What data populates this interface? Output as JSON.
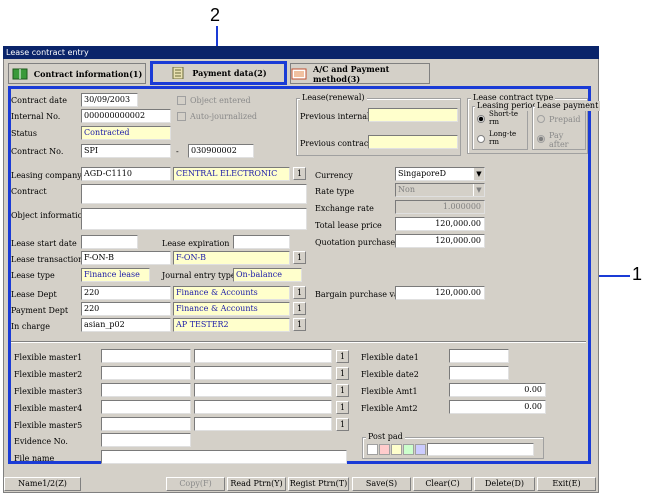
{
  "callouts": {
    "top": "2",
    "right": "1"
  },
  "window": {
    "title": "Lease contract entry"
  },
  "tabs": [
    {
      "label": "Contract information(1)"
    },
    {
      "label": "Payment data(2)"
    },
    {
      "label": "A/C and Payment method(3)"
    }
  ],
  "form": {
    "contract_date": {
      "label": "Contract date",
      "value": "30/09/2003"
    },
    "internal_no": {
      "label": "Internal No.",
      "value": "000000000002"
    },
    "status": {
      "label": "Status",
      "value": "Contracted"
    },
    "contract_no": {
      "label": "Contract No.",
      "value1": "SPI",
      "sep": "-",
      "value2": "030900002"
    },
    "object_entered": {
      "label": "Object entered"
    },
    "auto_journalized": {
      "label": "Auto-journalized"
    },
    "lease_renewal": {
      "title": "Lease(renewal)",
      "previous_internal": "Previous internal",
      "previous_contract": "Previous contract"
    },
    "lease_contract_type": {
      "title": "Lease contract type",
      "leasing_period": "Leasing period",
      "short": "Short-te rm",
      "long": "Long-te rm",
      "lease_payment": "Lease payment",
      "prepaid": "Prepaid",
      "pay_after": "Pay after"
    },
    "leasing_company": {
      "label": "Leasing company",
      "code": "AGD-C1110",
      "name": "CENTRAL ELECTRONIC"
    },
    "contract": {
      "label": "Contract"
    },
    "object_information": {
      "label": "Object information"
    },
    "currency": {
      "label": "Currency",
      "value": "SingaporeD"
    },
    "rate_type": {
      "label": "Rate type",
      "value": "Non"
    },
    "exchange_rate": {
      "label": "Exchange rate",
      "value": "1.000000"
    },
    "total_lease_price": {
      "label": "Total lease price",
      "value": "120,000.00"
    },
    "quotation_purchase": {
      "label": "Quotation purchase",
      "value": "120,000.00"
    },
    "lease_start_date": {
      "label": "Lease start date"
    },
    "lease_expiration": {
      "label": "Lease expiration"
    },
    "lease_transaction": {
      "label": "Lease transaction",
      "code": "F-ON-B",
      "name": "F-ON-B"
    },
    "lease_type": {
      "label": "Lease type",
      "value": "Finance lease"
    },
    "journal_entry_type": {
      "label": "Journal entry type",
      "value": "On-balance"
    },
    "lease_dept": {
      "label": "Lease Dept",
      "code": "220",
      "name": "Finance & Accounts"
    },
    "payment_dept": {
      "label": "Payment Dept",
      "code": "220",
      "name": "Finance & Accounts"
    },
    "in_charge": {
      "label": "In charge",
      "code": "asian_p02",
      "name": "AP TESTER2"
    },
    "bargain_purchase_value": {
      "label": "Bargain purchase value",
      "value": "120,000.00"
    },
    "lookup_label": "1"
  },
  "flex": {
    "masters": [
      "Flexible master1",
      "Flexible master2",
      "Flexible master3",
      "Flexible master4",
      "Flexible master5"
    ],
    "date1": "Flexible date1",
    "date2": "Flexible date2",
    "amt1": {
      "label": "Flexible Amt1",
      "value": "0.00"
    },
    "amt2": {
      "label": "Flexible Amt2",
      "value": "0.00"
    },
    "evidence_no": "Evidence No.",
    "file_name": "File name",
    "post_pad": "Post pad",
    "post_pad_colors": [
      "#ffffff",
      "#ffcccc",
      "#ffffcc",
      "#ccffcc",
      "#ccccff"
    ]
  },
  "buttons": {
    "name": "Name1/2(Z)",
    "copy": "Copy(F)",
    "read": "Read Ptrn(Y)",
    "regist": "Regist Ptrn(T)",
    "save": "Save(S)",
    "clear": "Clear(C)",
    "delete": "Delete(D)",
    "exit": "Exit(E)"
  }
}
